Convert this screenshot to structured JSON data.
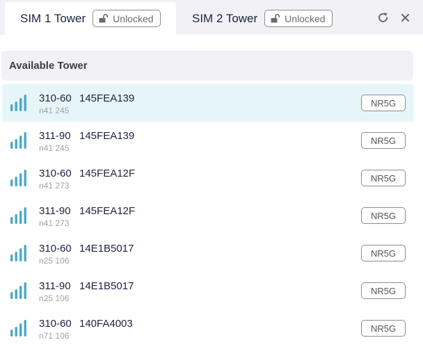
{
  "tabs": [
    {
      "label": "SIM 1 Tower",
      "lock_label": "Unlocked",
      "active": true
    },
    {
      "label": "SIM 2 Tower",
      "lock_label": "Unlocked",
      "active": false
    }
  ],
  "header_icons": {
    "refresh": "refresh-icon",
    "close": "close-icon"
  },
  "section": {
    "title": "Available Tower"
  },
  "towers": [
    {
      "plmn": "310-60",
      "cell_id": "145FEA139",
      "band": "n41 245",
      "tech": "NR5G"
    },
    {
      "plmn": "311-90",
      "cell_id": "145FEA139",
      "band": "n41 245",
      "tech": "NR5G"
    },
    {
      "plmn": "310-60",
      "cell_id": "145FEA12F",
      "band": "n41 273",
      "tech": "NR5G"
    },
    {
      "plmn": "311-90",
      "cell_id": "145FEA12F",
      "band": "n41 273",
      "tech": "NR5G"
    },
    {
      "plmn": "310-60",
      "cell_id": "14E1B5017",
      "band": "n25 106",
      "tech": "NR5G"
    },
    {
      "plmn": "311-90",
      "cell_id": "14E1B5017",
      "band": "n25 106",
      "tech": "NR5G"
    },
    {
      "plmn": "310-60",
      "cell_id": "140FA4003",
      "band": "n71 106",
      "tech": "NR5G"
    }
  ],
  "colors": {
    "signal": "#4aa8c8",
    "selected_row": "#e6f5f8",
    "header_bg": "#f2f1f6",
    "text_primary": "#1c2340",
    "text_secondary": "#a3a3a8"
  }
}
